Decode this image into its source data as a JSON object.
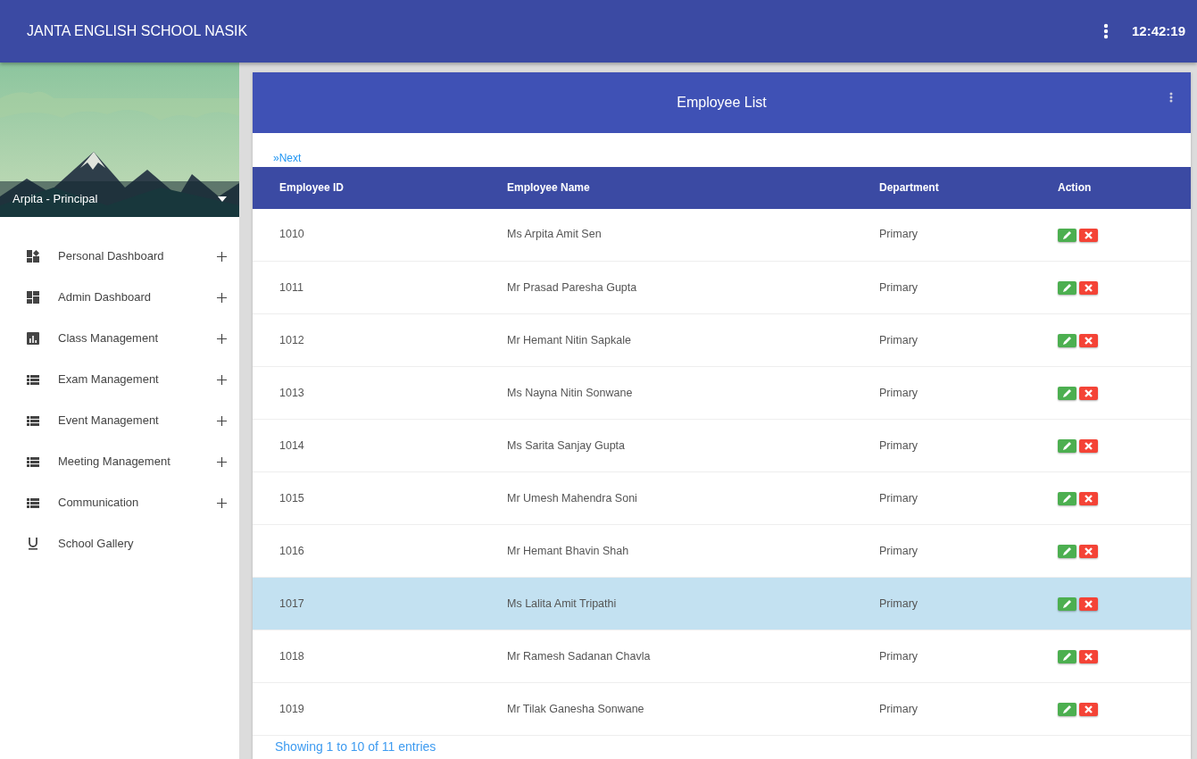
{
  "app_bar": {
    "title": "JANTA ENGLISH SCHOOL NASIK",
    "clock": "12:42:19"
  },
  "profile": {
    "user": "Arpita - Principal"
  },
  "sidebar": {
    "items": [
      {
        "label": "Personal Dashboard",
        "kind": "dashboard-plus",
        "expandable": true
      },
      {
        "label": "Admin Dashboard",
        "kind": "dashboard",
        "expandable": true
      },
      {
        "label": "Class Management",
        "kind": "chart",
        "expandable": true
      },
      {
        "label": "Exam Management",
        "kind": "list",
        "expandable": true
      },
      {
        "label": "Event Management",
        "kind": "list",
        "expandable": true
      },
      {
        "label": "Meeting Management",
        "kind": "list",
        "expandable": true
      },
      {
        "label": "Communication",
        "kind": "list",
        "expandable": true
      },
      {
        "label": "School Gallery",
        "kind": "underline",
        "expandable": false
      }
    ]
  },
  "card": {
    "title": "Employee List",
    "next_link": "»Next",
    "table": {
      "columns": [
        "Employee ID",
        "Employee Name",
        "Department",
        "Action"
      ],
      "rows": [
        {
          "id": "1010",
          "name": "Ms Arpita Amit Sen",
          "department": "Primary",
          "selected": false
        },
        {
          "id": "1011",
          "name": "Mr Prasad Paresha Gupta",
          "department": "Primary",
          "selected": false
        },
        {
          "id": "1012",
          "name": "Mr Hemant Nitin Sapkale",
          "department": "Primary",
          "selected": false
        },
        {
          "id": "1013",
          "name": "Ms Nayna Nitin Sonwane",
          "department": "Primary",
          "selected": false
        },
        {
          "id": "1014",
          "name": "Ms Sarita Sanjay Gupta",
          "department": "Primary",
          "selected": false
        },
        {
          "id": "1015",
          "name": "Mr Umesh Mahendra Soni",
          "department": "Primary",
          "selected": false
        },
        {
          "id": "1016",
          "name": "Mr Hemant Bhavin Shah",
          "department": "Primary",
          "selected": false
        },
        {
          "id": "1017",
          "name": "Ms Lalita Amit Tripathi",
          "department": "Primary",
          "selected": true
        },
        {
          "id": "1018",
          "name": "Mr Ramesh Sadanan Chavla",
          "department": "Primary",
          "selected": false
        },
        {
          "id": "1019",
          "name": "Mr Tilak Ganesha Sonwane",
          "department": "Primary",
          "selected": false
        }
      ]
    },
    "info": "Showing 1 to 10 of 11 entries"
  }
}
